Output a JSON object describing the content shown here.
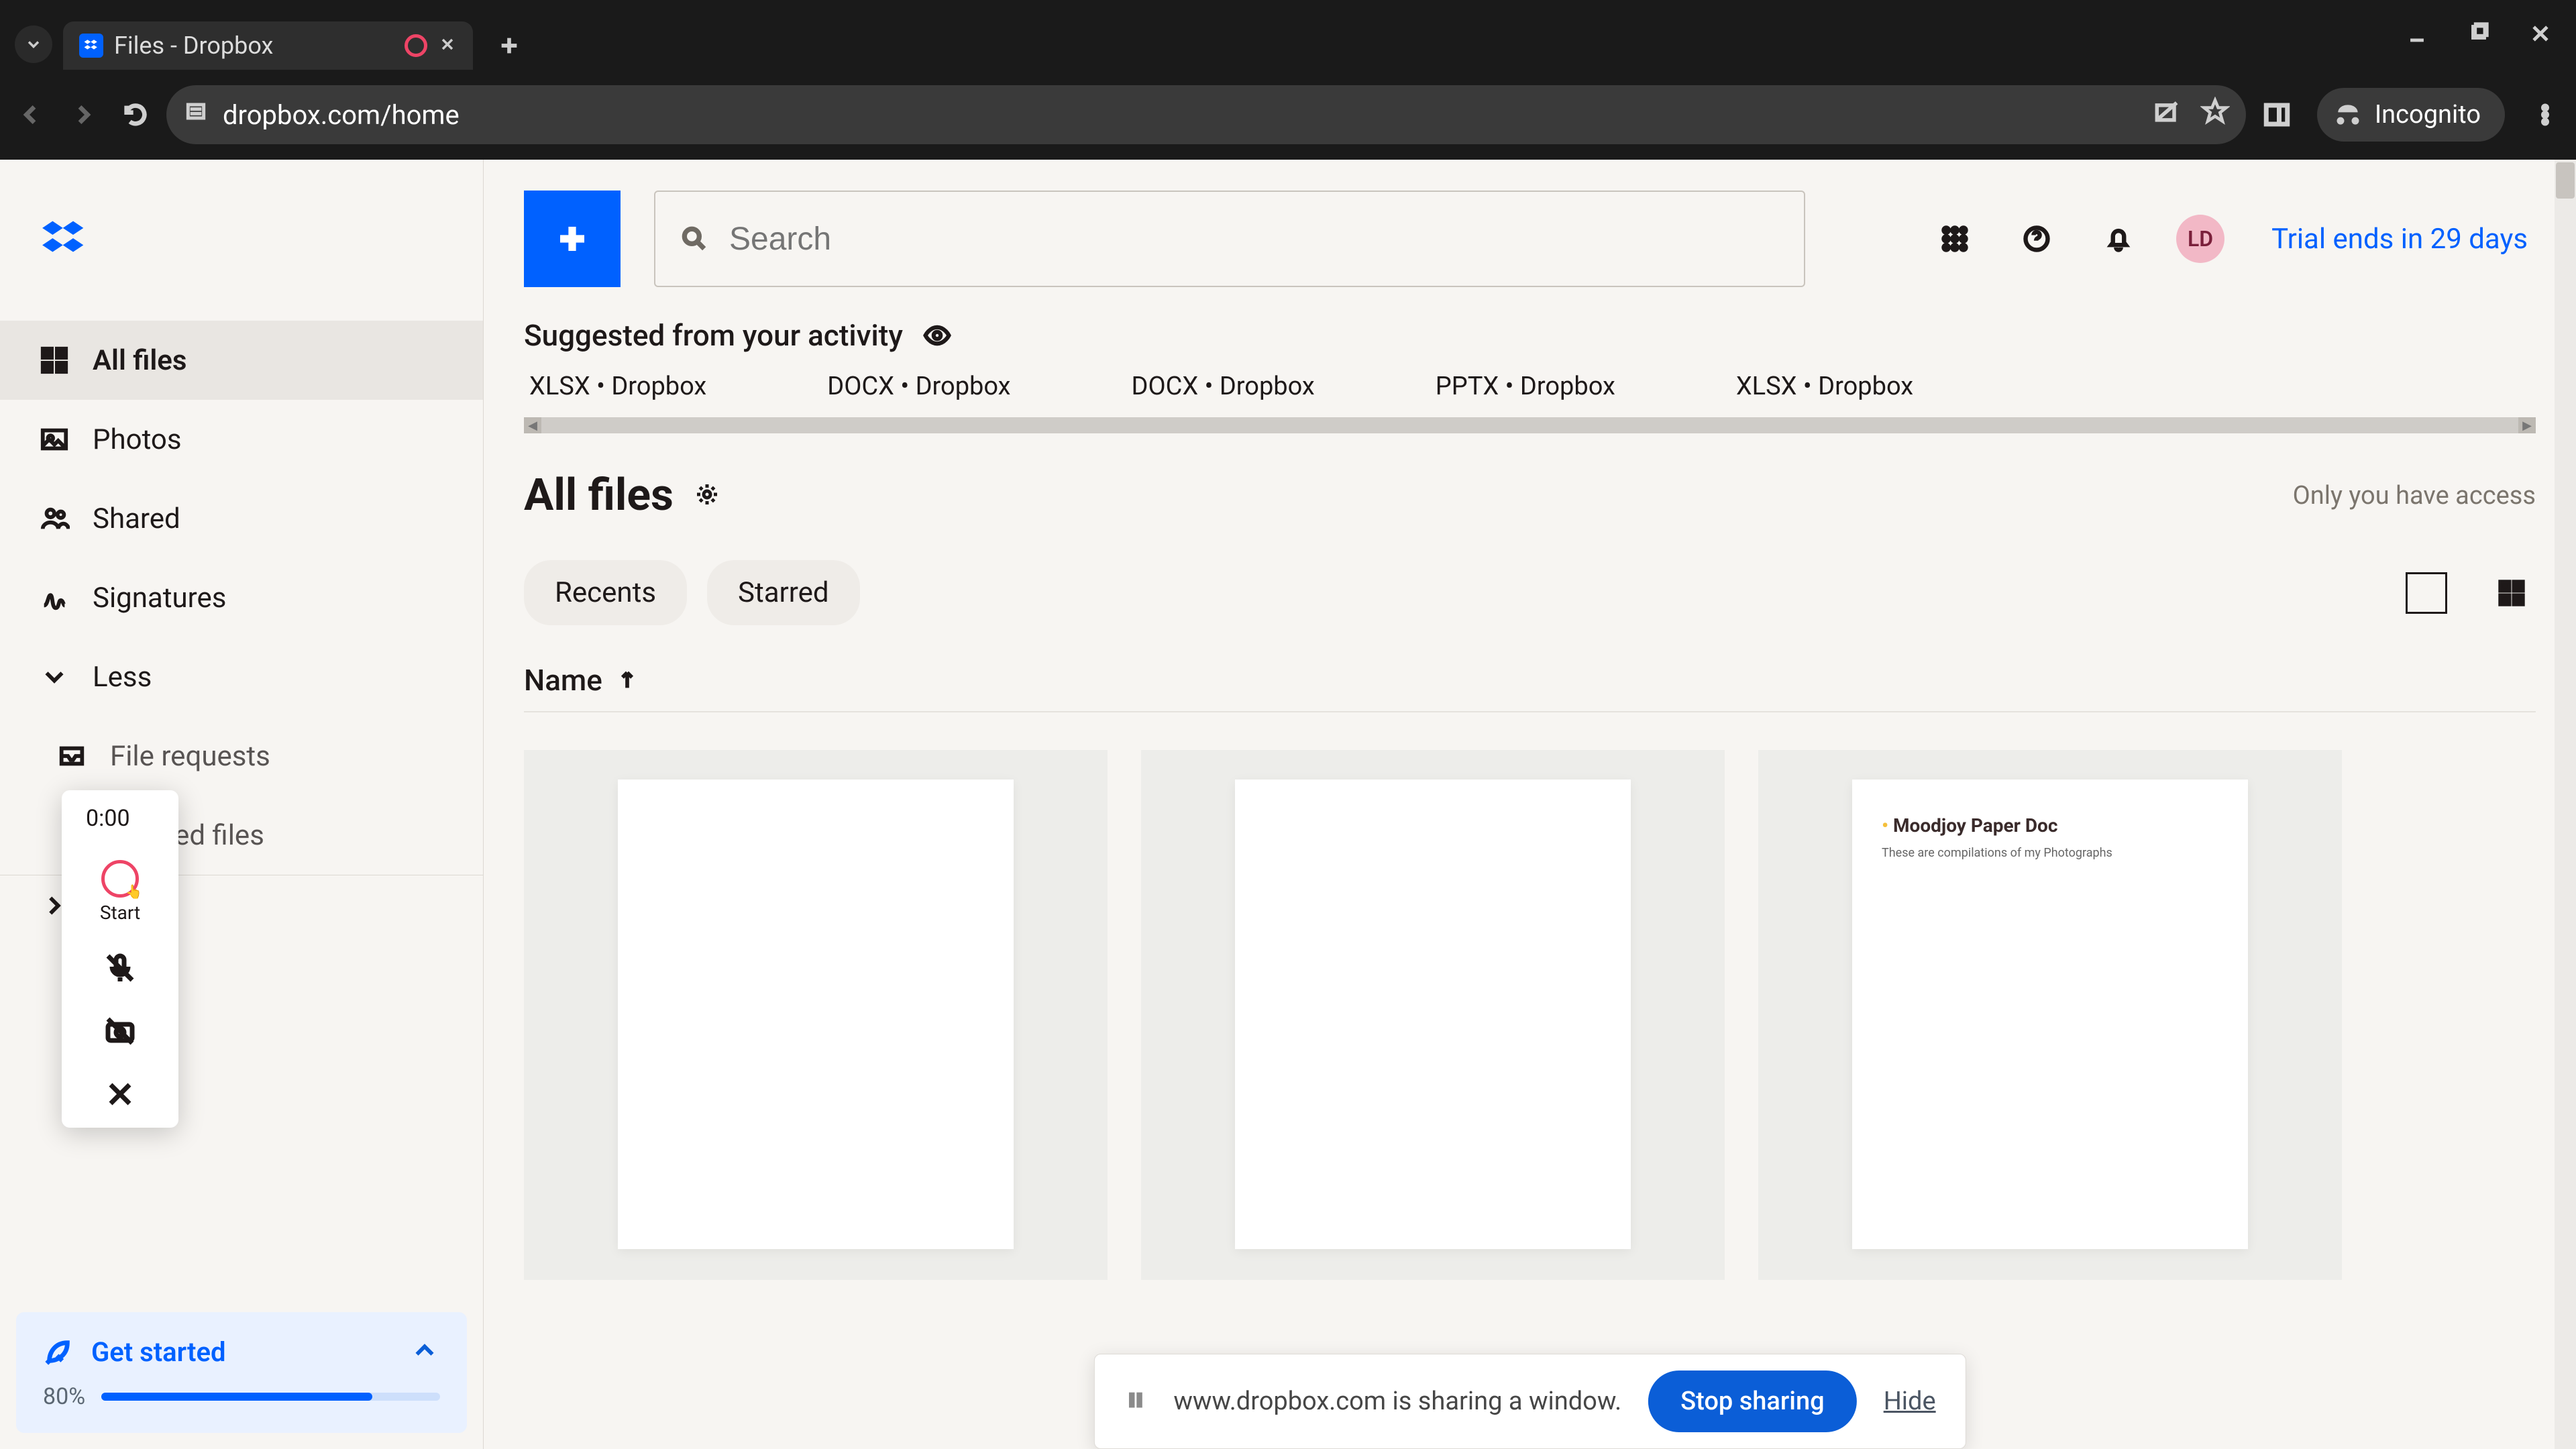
{
  "browser": {
    "tab_title": "Files - Dropbox",
    "url": "dropbox.com/home",
    "incognito_label": "Incognito"
  },
  "sidebar": {
    "items": [
      {
        "icon": "grid-icon",
        "label": "All files",
        "selected": true
      },
      {
        "icon": "photo-icon",
        "label": "Photos"
      },
      {
        "icon": "people-icon",
        "label": "Shared"
      },
      {
        "icon": "signature-icon",
        "label": "Signatures"
      }
    ],
    "less_label": "Less",
    "sub_items": [
      {
        "icon": "inbox-icon",
        "label": "File requests"
      },
      {
        "icon": "trash-icon",
        "label": "Deleted files"
      }
    ],
    "get_started": {
      "label": "Get started",
      "percent_text": "80%",
      "percent": 80
    }
  },
  "header": {
    "search_placeholder": "Search",
    "avatar_initials": "LD",
    "trial_text": "Trial ends in 29 days"
  },
  "suggested": {
    "title": "Suggested from your activity",
    "items": [
      "XLSX • Dropbox",
      "DOCX • Dropbox",
      "DOCX • Dropbox",
      "PPTX • Dropbox",
      "XLSX • Dropbox"
    ]
  },
  "main": {
    "title": "All files",
    "access_text": "Only you have access",
    "chips": [
      "Recents",
      "Starred"
    ],
    "name_header": "Name"
  },
  "paper_card": {
    "title": "Moodjoy Paper Doc",
    "subtitle": "These are compilations of my Photographs"
  },
  "recorder": {
    "time": "0:00",
    "start_label": "Start"
  },
  "share_bar": {
    "message": "www.dropbox.com is sharing a window.",
    "stop_label": "Stop sharing",
    "hide_label": "Hide"
  }
}
